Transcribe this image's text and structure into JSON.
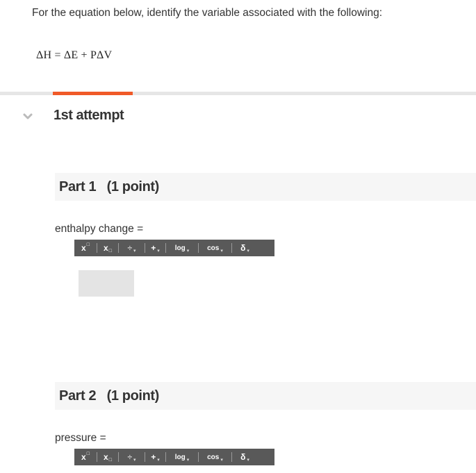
{
  "question": {
    "text": "For the equation below, identify the variable associated with the following:",
    "equation": "ΔH = ΔE + PΔV"
  },
  "attempt": {
    "title": "1st attempt"
  },
  "parts": [
    {
      "header": "Part 1   (1 point)",
      "prompt": "enthalpy change ="
    },
    {
      "header": "Part 2   (1 point)",
      "prompt": "pressure ="
    }
  ],
  "toolbar": {
    "superscript": "x",
    "subscript": "x",
    "fraction": "÷",
    "plus": "+",
    "log": "log",
    "cos": "cos",
    "delta": "δ",
    "caret": "▾"
  },
  "colors": {
    "accent": "#f05a28",
    "toolbar_bg": "#595959",
    "header_bg": "#f6f6f6",
    "answer_box": "#e4e4e4"
  },
  "icons": {
    "collapse": "chevron-down-icon"
  }
}
